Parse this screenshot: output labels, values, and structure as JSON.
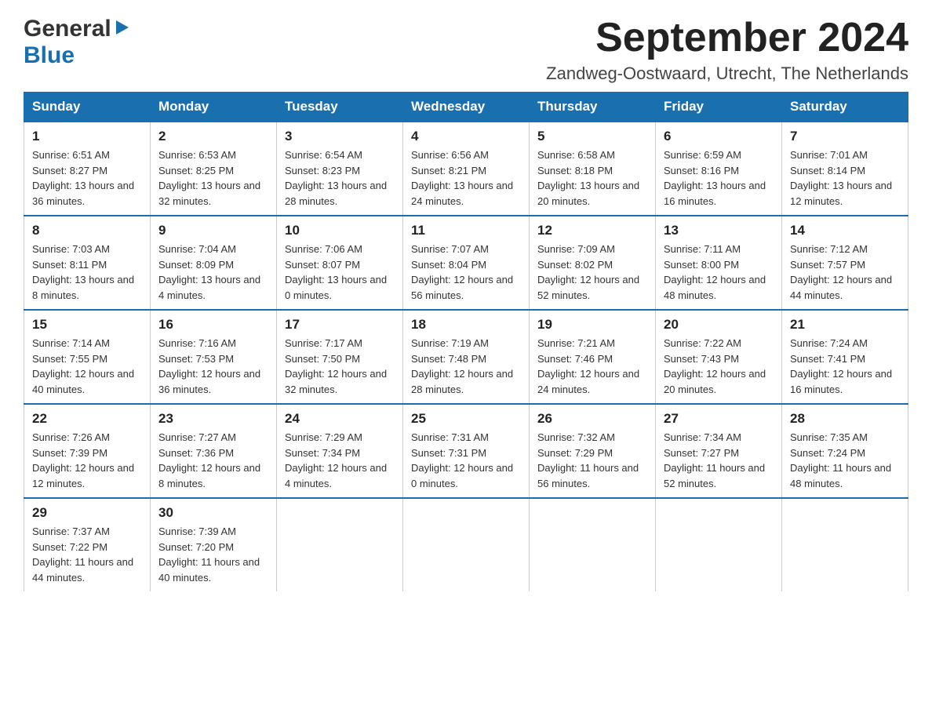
{
  "header": {
    "logo": {
      "general_text": "General",
      "blue_text": "Blue"
    },
    "month_year": "September 2024",
    "location": "Zandweg-Oostwaard, Utrecht, The Netherlands"
  },
  "calendar": {
    "days_of_week": [
      "Sunday",
      "Monday",
      "Tuesday",
      "Wednesday",
      "Thursday",
      "Friday",
      "Saturday"
    ],
    "weeks": [
      [
        {
          "day": "1",
          "sunrise": "Sunrise: 6:51 AM",
          "sunset": "Sunset: 8:27 PM",
          "daylight": "Daylight: 13 hours and 36 minutes."
        },
        {
          "day": "2",
          "sunrise": "Sunrise: 6:53 AM",
          "sunset": "Sunset: 8:25 PM",
          "daylight": "Daylight: 13 hours and 32 minutes."
        },
        {
          "day": "3",
          "sunrise": "Sunrise: 6:54 AM",
          "sunset": "Sunset: 8:23 PM",
          "daylight": "Daylight: 13 hours and 28 minutes."
        },
        {
          "day": "4",
          "sunrise": "Sunrise: 6:56 AM",
          "sunset": "Sunset: 8:21 PM",
          "daylight": "Daylight: 13 hours and 24 minutes."
        },
        {
          "day": "5",
          "sunrise": "Sunrise: 6:58 AM",
          "sunset": "Sunset: 8:18 PM",
          "daylight": "Daylight: 13 hours and 20 minutes."
        },
        {
          "day": "6",
          "sunrise": "Sunrise: 6:59 AM",
          "sunset": "Sunset: 8:16 PM",
          "daylight": "Daylight: 13 hours and 16 minutes."
        },
        {
          "day": "7",
          "sunrise": "Sunrise: 7:01 AM",
          "sunset": "Sunset: 8:14 PM",
          "daylight": "Daylight: 13 hours and 12 minutes."
        }
      ],
      [
        {
          "day": "8",
          "sunrise": "Sunrise: 7:03 AM",
          "sunset": "Sunset: 8:11 PM",
          "daylight": "Daylight: 13 hours and 8 minutes."
        },
        {
          "day": "9",
          "sunrise": "Sunrise: 7:04 AM",
          "sunset": "Sunset: 8:09 PM",
          "daylight": "Daylight: 13 hours and 4 minutes."
        },
        {
          "day": "10",
          "sunrise": "Sunrise: 7:06 AM",
          "sunset": "Sunset: 8:07 PM",
          "daylight": "Daylight: 13 hours and 0 minutes."
        },
        {
          "day": "11",
          "sunrise": "Sunrise: 7:07 AM",
          "sunset": "Sunset: 8:04 PM",
          "daylight": "Daylight: 12 hours and 56 minutes."
        },
        {
          "day": "12",
          "sunrise": "Sunrise: 7:09 AM",
          "sunset": "Sunset: 8:02 PM",
          "daylight": "Daylight: 12 hours and 52 minutes."
        },
        {
          "day": "13",
          "sunrise": "Sunrise: 7:11 AM",
          "sunset": "Sunset: 8:00 PM",
          "daylight": "Daylight: 12 hours and 48 minutes."
        },
        {
          "day": "14",
          "sunrise": "Sunrise: 7:12 AM",
          "sunset": "Sunset: 7:57 PM",
          "daylight": "Daylight: 12 hours and 44 minutes."
        }
      ],
      [
        {
          "day": "15",
          "sunrise": "Sunrise: 7:14 AM",
          "sunset": "Sunset: 7:55 PM",
          "daylight": "Daylight: 12 hours and 40 minutes."
        },
        {
          "day": "16",
          "sunrise": "Sunrise: 7:16 AM",
          "sunset": "Sunset: 7:53 PM",
          "daylight": "Daylight: 12 hours and 36 minutes."
        },
        {
          "day": "17",
          "sunrise": "Sunrise: 7:17 AM",
          "sunset": "Sunset: 7:50 PM",
          "daylight": "Daylight: 12 hours and 32 minutes."
        },
        {
          "day": "18",
          "sunrise": "Sunrise: 7:19 AM",
          "sunset": "Sunset: 7:48 PM",
          "daylight": "Daylight: 12 hours and 28 minutes."
        },
        {
          "day": "19",
          "sunrise": "Sunrise: 7:21 AM",
          "sunset": "Sunset: 7:46 PM",
          "daylight": "Daylight: 12 hours and 24 minutes."
        },
        {
          "day": "20",
          "sunrise": "Sunrise: 7:22 AM",
          "sunset": "Sunset: 7:43 PM",
          "daylight": "Daylight: 12 hours and 20 minutes."
        },
        {
          "day": "21",
          "sunrise": "Sunrise: 7:24 AM",
          "sunset": "Sunset: 7:41 PM",
          "daylight": "Daylight: 12 hours and 16 minutes."
        }
      ],
      [
        {
          "day": "22",
          "sunrise": "Sunrise: 7:26 AM",
          "sunset": "Sunset: 7:39 PM",
          "daylight": "Daylight: 12 hours and 12 minutes."
        },
        {
          "day": "23",
          "sunrise": "Sunrise: 7:27 AM",
          "sunset": "Sunset: 7:36 PM",
          "daylight": "Daylight: 12 hours and 8 minutes."
        },
        {
          "day": "24",
          "sunrise": "Sunrise: 7:29 AM",
          "sunset": "Sunset: 7:34 PM",
          "daylight": "Daylight: 12 hours and 4 minutes."
        },
        {
          "day": "25",
          "sunrise": "Sunrise: 7:31 AM",
          "sunset": "Sunset: 7:31 PM",
          "daylight": "Daylight: 12 hours and 0 minutes."
        },
        {
          "day": "26",
          "sunrise": "Sunrise: 7:32 AM",
          "sunset": "Sunset: 7:29 PM",
          "daylight": "Daylight: 11 hours and 56 minutes."
        },
        {
          "day": "27",
          "sunrise": "Sunrise: 7:34 AM",
          "sunset": "Sunset: 7:27 PM",
          "daylight": "Daylight: 11 hours and 52 minutes."
        },
        {
          "day": "28",
          "sunrise": "Sunrise: 7:35 AM",
          "sunset": "Sunset: 7:24 PM",
          "daylight": "Daylight: 11 hours and 48 minutes."
        }
      ],
      [
        {
          "day": "29",
          "sunrise": "Sunrise: 7:37 AM",
          "sunset": "Sunset: 7:22 PM",
          "daylight": "Daylight: 11 hours and 44 minutes."
        },
        {
          "day": "30",
          "sunrise": "Sunrise: 7:39 AM",
          "sunset": "Sunset: 7:20 PM",
          "daylight": "Daylight: 11 hours and 40 minutes."
        },
        null,
        null,
        null,
        null,
        null
      ]
    ]
  }
}
